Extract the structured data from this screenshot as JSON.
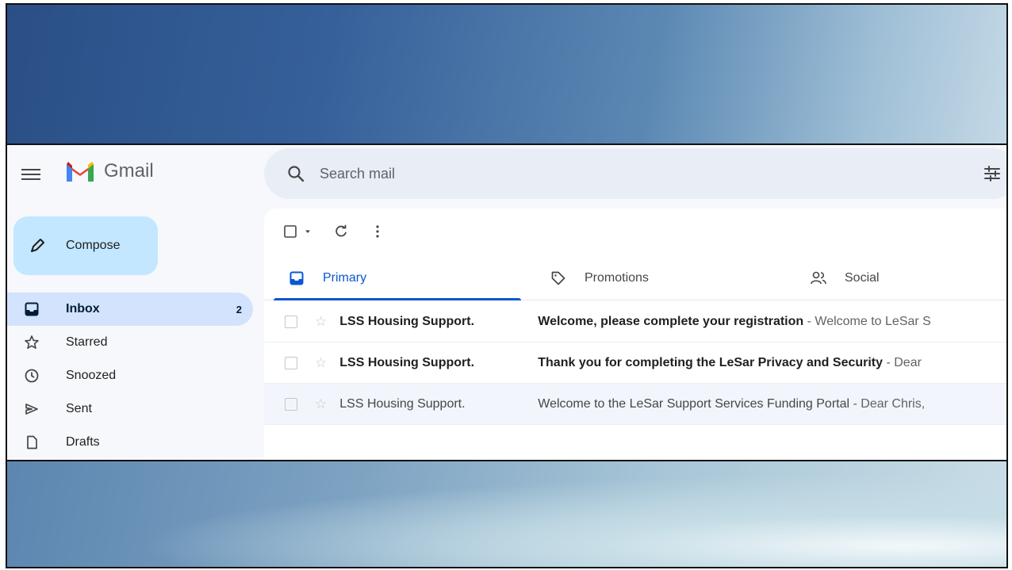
{
  "app": {
    "name": "Gmail"
  },
  "search": {
    "placeholder": "Search mail"
  },
  "compose": {
    "label": "Compose"
  },
  "sidebar": {
    "items": [
      {
        "label": "Inbox",
        "icon": "inbox-icon",
        "count": "2",
        "active": true
      },
      {
        "label": "Starred",
        "icon": "star-icon",
        "count": ""
      },
      {
        "label": "Snoozed",
        "icon": "clock-icon",
        "count": ""
      },
      {
        "label": "Sent",
        "icon": "send-icon",
        "count": ""
      },
      {
        "label": "Drafts",
        "icon": "draft-icon",
        "count": ""
      }
    ]
  },
  "tabs": [
    {
      "label": "Primary",
      "icon": "inbox-icon",
      "active": true
    },
    {
      "label": "Promotions",
      "icon": "tag-icon"
    },
    {
      "label": "Social",
      "icon": "people-icon"
    }
  ],
  "emails": [
    {
      "sender": "LSS Housing Support.",
      "subject": "Welcome, please complete your registration",
      "snippet": " - Welcome to LeSar S",
      "unread": true
    },
    {
      "sender": "LSS Housing Support.",
      "subject": "Thank you for completing the LeSar Privacy and Security",
      "snippet": " - Dear",
      "unread": true
    },
    {
      "sender": "LSS Housing Support.",
      "subject": "Welcome to the LeSar Support Services Funding Portal",
      "snippet": " - Dear Chris,",
      "unread": false
    }
  ],
  "colors": {
    "accent": "#0b57d0",
    "compose_bg": "#c2e7ff",
    "active_nav_bg": "#d3e3fd",
    "search_bg": "#e9eef6"
  }
}
